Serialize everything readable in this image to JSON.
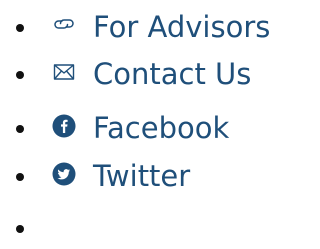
{
  "links": {
    "advisors": {
      "label": "For Advisors",
      "icon": "link-icon"
    },
    "contact": {
      "label": "Contact Us",
      "icon": "envelope-icon"
    },
    "facebook": {
      "label": "Facebook",
      "icon": "facebook-icon"
    },
    "twitter": {
      "label": "Twitter",
      "icon": "twitter-icon"
    }
  },
  "colors": {
    "link": "#1f4f7a",
    "bullet": "#111111"
  }
}
